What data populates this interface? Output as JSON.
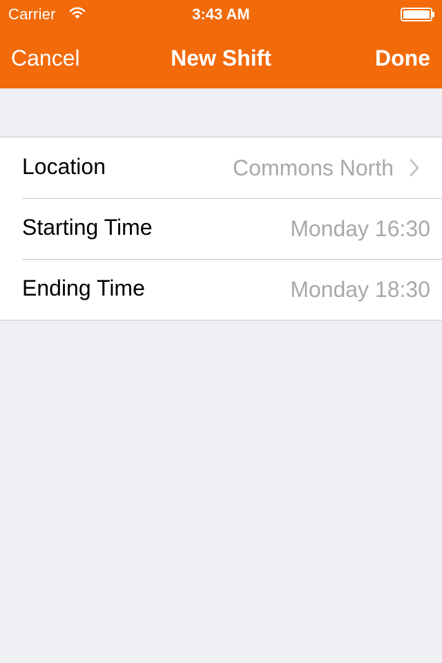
{
  "status_bar": {
    "carrier": "Carrier",
    "time": "3:43 AM"
  },
  "nav": {
    "cancel_label": "Cancel",
    "title": "New Shift",
    "done_label": "Done"
  },
  "rows": [
    {
      "label": "Location",
      "value": "Commons North",
      "icon": "chevron-right-icon"
    },
    {
      "label": "Starting Time",
      "value": "Monday 16:30"
    },
    {
      "label": "Ending Time",
      "value": "Monday 18:30"
    }
  ],
  "colors": {
    "accent": "#f26a0a",
    "background": "#efeff4",
    "value_text": "#a8a8ad"
  }
}
